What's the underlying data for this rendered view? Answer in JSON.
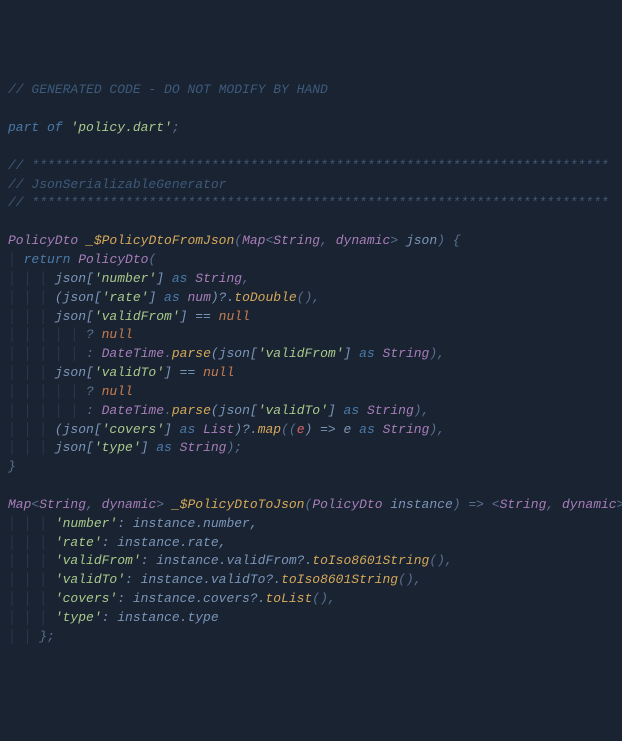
{
  "lines": {
    "l1": "// GENERATED CODE - DO NOT MODIFY BY HAND",
    "l2_1": "part of",
    "l2_2": "'policy.dart'",
    "l2_3": ";",
    "l3": "// **************************************************************************",
    "l4": "// JsonSerializableGenerator",
    "l5": "// **************************************************************************",
    "l6_type1": "PolicyDto",
    "l6_fn": "_$PolicyDtoFromJson",
    "l6_p1": "(",
    "l6_type2": "Map",
    "l6_lt": "<",
    "l6_type3": "String",
    "l6_comma": ", ",
    "l6_type4": "dynamic",
    "l6_gt": ">",
    "l6_param": " json",
    "l6_p2": ") {",
    "l7_1": "return",
    "l7_2": "PolicyDto",
    "l7_3": "(",
    "l8_1": "json[",
    "l8_2": "'number'",
    "l8_3": "] ",
    "l8_as": "as",
    "l8_type": "String",
    "l8_end": ",",
    "l9_1": "(json[",
    "l9_2": "'rate'",
    "l9_3": "] ",
    "l9_as": "as",
    "l9_type": "num",
    "l9_4": ")?.",
    "l9_m": "toDouble",
    "l9_5": "(),",
    "l10_1": "json[",
    "l10_2": "'validFrom'",
    "l10_3": "] == ",
    "l10_null": "null",
    "l11_q": "? ",
    "l11_null": "null",
    "l12_c": ": ",
    "l12_type": "DateTime",
    "l12_dot": ".",
    "l12_m": "parse",
    "l12_p1": "(json[",
    "l12_s": "'validFrom'",
    "l12_p2": "] ",
    "l12_as": "as",
    "l12_t2": "String",
    "l12_end": "),",
    "l13_1": "json[",
    "l13_2": "'validTo'",
    "l13_3": "] == ",
    "l13_null": "null",
    "l14_q": "? ",
    "l14_null": "null",
    "l15_c": ": ",
    "l15_type": "DateTime",
    "l15_dot": ".",
    "l15_m": "parse",
    "l15_p1": "(json[",
    "l15_s": "'validTo'",
    "l15_p2": "] ",
    "l15_as": "as",
    "l15_t2": "String",
    "l15_end": "),",
    "l16_1": "(json[",
    "l16_2": "'covers'",
    "l16_3": "] ",
    "l16_as": "as",
    "l16_type": "List",
    "l16_4": ")?.",
    "l16_m": "map",
    "l16_5": "((",
    "l16_e": "e",
    "l16_6": ") => e ",
    "l16_as2": "as",
    "l16_t2": "String",
    "l16_end": "),",
    "l17_1": "json[",
    "l17_2": "'type'",
    "l17_3": "] ",
    "l17_as": "as",
    "l17_type": "String",
    "l17_end": ");",
    "l18": "}",
    "l19_type1": "Map",
    "l19_lt": "<",
    "l19_type2": "String",
    "l19_comma": ", ",
    "l19_type3": "dynamic",
    "l19_gt": ">",
    "l19_fn": " _$PolicyDtoToJson",
    "l19_p1": "(",
    "l19_ptype": "PolicyDto",
    "l19_param": " instance",
    "l19_p2": ") => <",
    "l19_type4": "String",
    "l19_comma2": ", ",
    "l19_type5": "dynamic",
    "l19_end": ">{",
    "l20_k": "'number'",
    "l20_c": ": instance.number,",
    "l21_k": "'rate'",
    "l21_c": ": instance.rate,",
    "l22_k": "'validFrom'",
    "l22_c": ": instance.validFrom?.",
    "l22_m": "toIso8601String",
    "l22_end": "(),",
    "l23_k": "'validTo'",
    "l23_c": ": instance.validTo?.",
    "l23_m": "toIso8601String",
    "l23_end": "(),",
    "l24_k": "'covers'",
    "l24_c": ": instance.covers?.",
    "l24_m": "toList",
    "l24_end": "(),",
    "l25_k": "'type'",
    "l25_c": ": instance.type",
    "l26": "};"
  }
}
